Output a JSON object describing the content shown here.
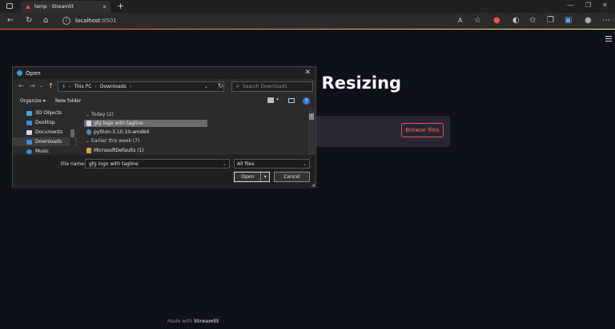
{
  "browser": {
    "tab_title": "temp · Streamlit",
    "new_tab": "+",
    "address_host": "localhost",
    "address_port": ":8501",
    "window_controls": [
      "—",
      "❐",
      "✕"
    ]
  },
  "page": {
    "heading": "e Resizing",
    "browse_button": "Browse files",
    "footer_prefix": "Made with",
    "footer_brand": "Streamlit"
  },
  "dialog": {
    "title": "Open",
    "path": [
      "This PC",
      "Downloads"
    ],
    "search_placeholder": "Search Downloads",
    "organize": "Organize ▾",
    "new_folder": "New folder",
    "sidebar": [
      {
        "label": "3D Objects",
        "icon": "cube-icon",
        "color": "#4aa3df"
      },
      {
        "label": "Desktop",
        "icon": "desktop-icon",
        "color": "#3b8fd9"
      },
      {
        "label": "Documents",
        "icon": "documents-icon",
        "color": "#cfd8e3"
      },
      {
        "label": "Downloads",
        "icon": "download-icon",
        "color": "#3b8fd9"
      },
      {
        "label": "Music",
        "icon": "music-icon",
        "color": "#3b8fd9"
      }
    ],
    "groups": [
      {
        "label": "Today (2)"
      },
      {
        "label": "Earlier this week (7)"
      }
    ],
    "files": [
      {
        "label": "gfg logo with tagline",
        "icon": "image-file-icon"
      },
      {
        "label": "python-3.10.10-amd64",
        "icon": "python-installer-icon"
      },
      {
        "label": "MicrosoftDefaults (1)",
        "icon": "folder-icon"
      }
    ],
    "file_name_label": "File name:",
    "file_name_value": "gfg logo with tagline",
    "file_type": "All files",
    "open_button": "Open",
    "cancel_button": "Cancel"
  },
  "colors": {
    "accent": "#ff4b4b",
    "background": "#0e1117",
    "dialog_bg": "#2b2b2b"
  }
}
